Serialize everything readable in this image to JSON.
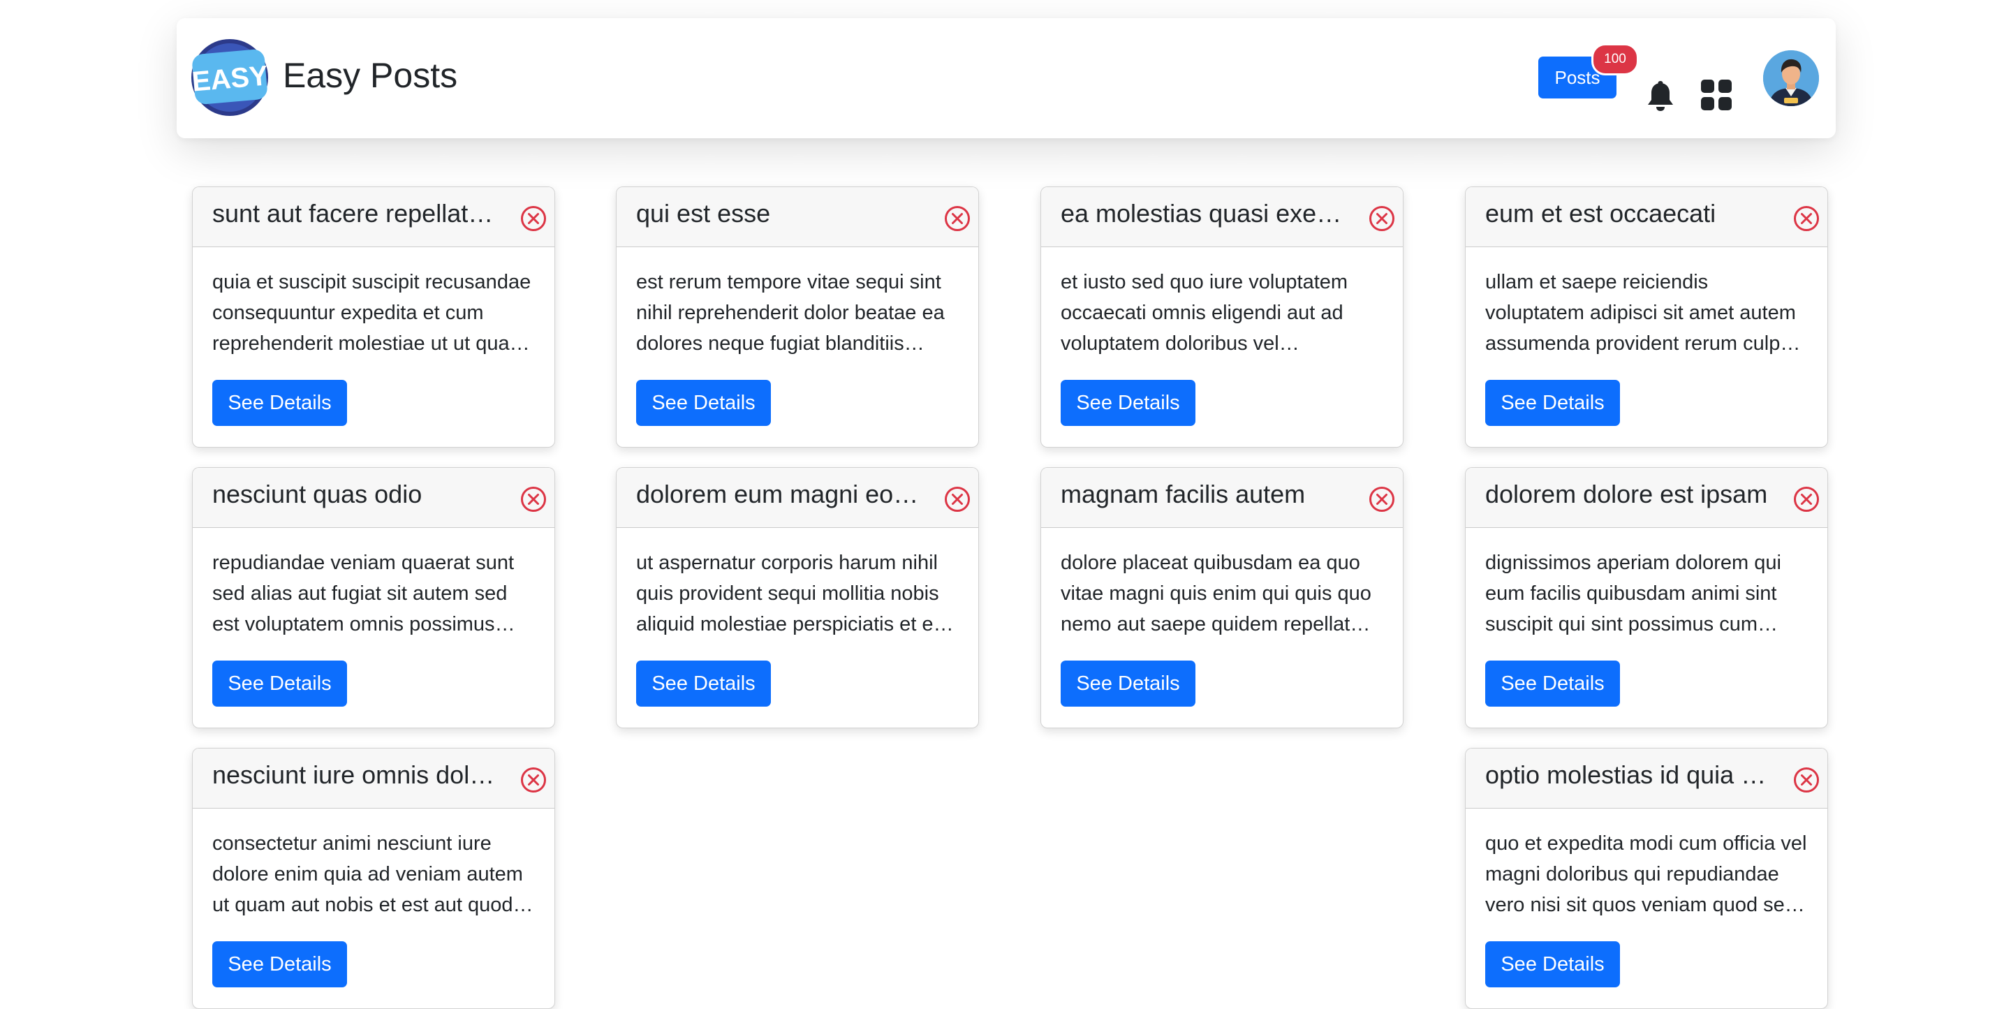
{
  "app": {
    "brand": "Easy Posts",
    "logo_text": "EASY",
    "posts_label": "Posts",
    "posts_count": "100"
  },
  "colors": {
    "primary": "#0d6efd",
    "danger": "#dc3545",
    "card_header_bg": "#f7f7f7"
  },
  "icons": [
    "bell-icon",
    "apps-grid-icon",
    "close-circle-icon"
  ],
  "details_label": "See Details",
  "posts": [
    {
      "title": "sunt aut facere repellat provident occaecati excepturi optio reprehenderit",
      "body": "quia et suscipit suscipit recusandae consequuntur expedita et cum reprehenderit molestiae ut ut quas totam nostrum rerum est autem sunt rem eveniet architecto"
    },
    {
      "title": "qui est esse",
      "body": "est rerum tempore vitae sequi sint nihil reprehenderit dolor beatae ea dolores neque fugiat blanditiis voluptate porro vel nihil molestiae ut reiciendis qui aperiam non debitis possimus qui neque nisi nulla"
    },
    {
      "title": "ea molestias quasi exercitationem repellat qui ipsa sit aut",
      "body": "et iusto sed quo iure voluptatem occaecati omnis eligendi aut ad voluptatem doloribus vel accusantium quis pariatur molestiae porro eius odio et labore et velit aut"
    },
    {
      "title": "eum et est occaecati",
      "body": "ullam et saepe reiciendis voluptatem adipisci sit amet autem assumenda provident rerum culpa quis hic commodi nesciunt rem tenetur doloremque ipsam iure quis sunt voluptatem rerum illo velit"
    },
    {
      "title": "nesciunt quas odio",
      "body": "repudiandae veniam quaerat sunt sed alias aut fugiat sit autem sed est voluptatem omnis possimus esse voluptatibus quis est aut tenetur dolor neque"
    },
    {
      "title": "dolorem eum magni eos aperiam quia",
      "body": "ut aspernatur corporis harum nihil quis provident sequi mollitia nobis aliquid molestiae perspiciatis et ea nemo ab reprehenderit accusantium quas voluptate dolores velit et doloremque molestiae"
    },
    {
      "title": "magnam facilis autem",
      "body": "dolore placeat quibusdam ea quo vitae magni quis enim qui quis quo nemo aut saepe quidem repellat excepturi ut quia sunt ut sequi eos ea sed quas"
    },
    {
      "title": "dolorem dolore est ipsam",
      "body": "dignissimos aperiam dolorem qui eum facilis quibusdam animi sint suscipit qui sint possimus cum quaerat magni maiores excepturi ipsam ut commodi dolor voluptatum modi aut vitae"
    },
    {
      "title": "nesciunt iure omnis dolorem tempora et accusantium",
      "body": "consectetur animi nesciunt iure dolore enim quia ad veniam autem ut quam aut nobis et est aut quod aut provident voluptas autem voluptas"
    },
    {
      "title": "optio molestias id quia eum",
      "body": "quo et expedita modi cum officia vel magni doloribus qui repudiandae vero nisi sit quos veniam quod sed accusamus veritatis error"
    }
  ]
}
